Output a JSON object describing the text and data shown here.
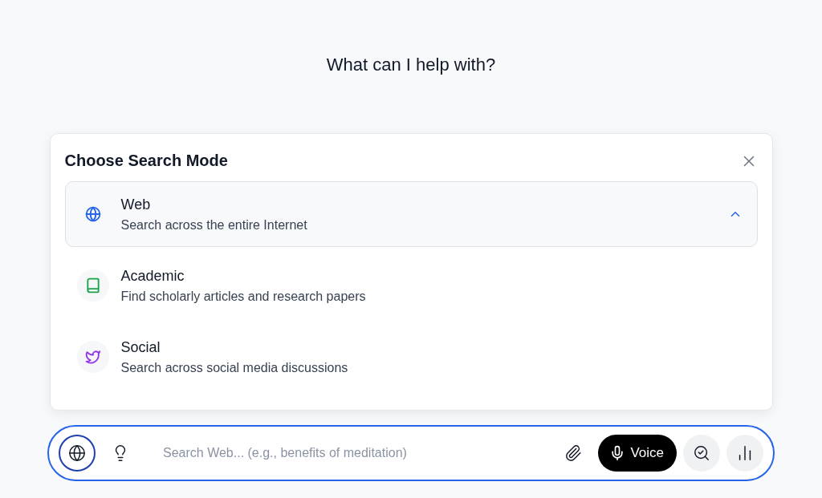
{
  "heading": "What can I help with?",
  "panel": {
    "title": "Choose Search Mode",
    "modes": [
      {
        "kind": "web",
        "label": "Web",
        "description": "Search across the entire Internet",
        "selected": true,
        "color": "#2563eb"
      },
      {
        "kind": "academic",
        "label": "Academic",
        "description": "Find scholarly articles and research papers",
        "selected": false,
        "color": "#16a34a"
      },
      {
        "kind": "social",
        "label": "Social",
        "description": "Search across social media discussions",
        "selected": false,
        "color": "#9333ea"
      }
    ]
  },
  "search": {
    "placeholder": "Search Web... (e.g., benefits of meditation)",
    "voice_label": "Voice"
  }
}
